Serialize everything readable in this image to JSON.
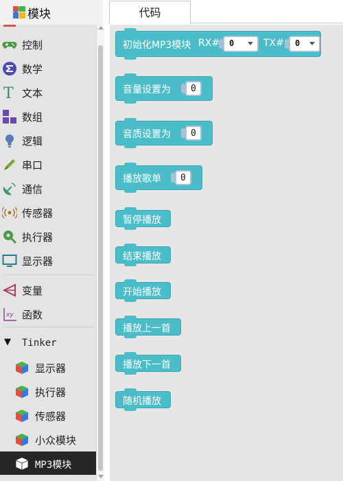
{
  "header": {
    "title": "模块",
    "title_icon": "puzzle-icon",
    "tab_label": "代码"
  },
  "sidebar": {
    "categories": [
      {
        "id": "control",
        "label": "控制",
        "icon": "gamepad-icon",
        "color": "#4a9a4a"
      },
      {
        "id": "math",
        "label": "数学",
        "icon": "math-sigma-icon",
        "color": "#4a4ab0"
      },
      {
        "id": "text",
        "label": "文本",
        "icon": "text-t-icon",
        "color": "#3a8a7a"
      },
      {
        "id": "array",
        "label": "数组",
        "icon": "array-blocks-icon",
        "color": "#6a4aa8"
      },
      {
        "id": "logic",
        "label": "逻辑",
        "icon": "lightbulb-icon",
        "color": "#5a7ab8"
      },
      {
        "id": "serial",
        "label": "串口",
        "icon": "pen-icon",
        "color": "#7aa830"
      },
      {
        "id": "comm",
        "label": "通信",
        "icon": "satellite-dish-icon",
        "color": "#3a9a6a"
      },
      {
        "id": "sensor",
        "label": "传感器",
        "icon": "sensor-wave-icon",
        "color": "#a87830"
      },
      {
        "id": "actuator",
        "label": "执行器",
        "icon": "actuator-icon",
        "color": "#4a9a4a"
      },
      {
        "id": "display",
        "label": "显示器",
        "icon": "monitor-icon",
        "color": "#2a7a8a"
      }
    ],
    "extras": [
      {
        "id": "variable",
        "label": "变量",
        "icon": "variable-icon",
        "color": "#a83a6a"
      },
      {
        "id": "function",
        "label": "函数",
        "icon": "function-xy-icon",
        "color": "#8a3a9a"
      }
    ],
    "tinker": {
      "label": "Tinker",
      "items": [
        {
          "id": "t-display",
          "label": "显示器",
          "icon": "cube-icon"
        },
        {
          "id": "t-actuator",
          "label": "执行器",
          "icon": "cube-icon"
        },
        {
          "id": "t-sensor",
          "label": "传感器",
          "icon": "cube-icon"
        },
        {
          "id": "t-misc",
          "label": "小众模块",
          "icon": "cube-icon"
        },
        {
          "id": "t-mp3",
          "label": "MP3模块",
          "icon": "cube-icon",
          "selected": true
        }
      ]
    }
  },
  "blocks": {
    "init": {
      "label": "初始化MP3模块",
      "rx_label": "RX#",
      "rx_value": "0",
      "tx_label": "TX#",
      "tx_value": "0"
    },
    "volume": {
      "label": "音量设置为",
      "value": "0"
    },
    "quality": {
      "label": "音质设置为",
      "value": "0"
    },
    "play_song": {
      "label": "播放歌单",
      "value": "0"
    },
    "pause": {
      "label": "暂停播放"
    },
    "stop": {
      "label": "结束播放"
    },
    "start": {
      "label": "开始播放"
    },
    "prev": {
      "label": "播放上一首"
    },
    "next": {
      "label": "播放下一首"
    },
    "random": {
      "label": "随机播放"
    }
  },
  "colors": {
    "block": "#4bbdc8",
    "selected_bg": "#262626",
    "sidebar_bg": "#e4e4e4",
    "workspace_bg": "#e6e6e6"
  }
}
